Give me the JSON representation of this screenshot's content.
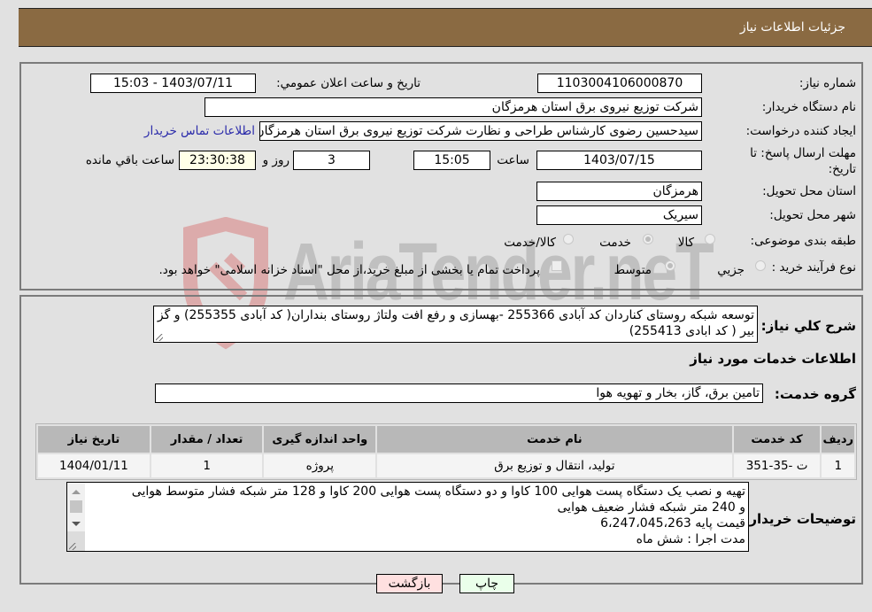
{
  "header": {
    "title": "جزئیات اطلاعات نیاز"
  },
  "form": {
    "need_number": {
      "label": "شماره نیاز:",
      "value": "1103004106000870"
    },
    "announce_datetime": {
      "label": "تاریخ و ساعت اعلان عمومي:",
      "value": "1403/07/11 - 15:03"
    },
    "buyer_org": {
      "label": "نام دستگاه خریدار:",
      "value": "شرکت توزیع نیروی برق استان هرمزگان"
    },
    "requester": {
      "label": "ایجاد کننده درخواست:",
      "value": "سیدحسین رضوی کارشناس طراحی و نظارت شرکت توزیع نیروی برق استان هرمزگان",
      "contact_link": "اطلاعات تماس خریدار"
    },
    "deadline": {
      "label_line1": "مهلت ارسال پاسخ: تا",
      "label_line2": "تاریخ:",
      "date": "1403/07/15",
      "time_label": "ساعت",
      "time": "15:05",
      "days": "3",
      "days_label": "روز و",
      "remaining": "23:30:38",
      "remaining_label": "ساعت باقي مانده"
    },
    "province": {
      "label": "استان محل تحویل:",
      "value": "هرمزگان"
    },
    "city": {
      "label": "شهر محل تحویل:",
      "value": "سیریک"
    },
    "category": {
      "label": "طبقه بندی موضوعی:",
      "options": [
        {
          "label": "کالا",
          "selected": false
        },
        {
          "label": "خدمت",
          "selected": true
        },
        {
          "label": "کالا/خدمت",
          "selected": false
        }
      ]
    },
    "process": {
      "label": "نوع فرآیند خرید :",
      "options": [
        {
          "label": "جزيي",
          "selected": false
        },
        {
          "label": "متوسط",
          "selected": true
        }
      ],
      "treasury_checkbox_label": "پرداخت تمام یا بخشی از مبلغ خرید،از محل \"اسناد خزانه اسلامی\" خواهد بود.",
      "treasury_checked": false
    }
  },
  "description": {
    "label": "شرح کلي نیاز:",
    "value": "توسعه شبکه روستای کناردان کد آبادی 255366 -بهسازی و رفع افت ولتاژ روستای بنداران( کد آبادی 255355) و گز بیر ( کد ابادی 255413)"
  },
  "services": {
    "section_title": "اطلاعات خدمات مورد نیاز",
    "group_label": "گروه خدمت:",
    "group_value": "تامین برق، گاز، بخار و تهویه هوا",
    "table": {
      "headers": [
        "ردیف",
        "کد خدمت",
        "نام خدمت",
        "واحد اندازه گیری",
        "تعداد / مقدار",
        "تاریخ نیاز"
      ],
      "rows": [
        [
          "1",
          "ت -35-351",
          "تولید، انتقال و توزیع برق",
          "پروژه",
          "1",
          "1404/01/11"
        ]
      ]
    }
  },
  "buyer_notes": {
    "label": "توضیحات خریدار:",
    "lines": [
      "تهیه و نصب یک دستگاه پست هوایی 100 کاوا و دو دستگاه پست هوایی 200 کاوا و 128 متر شبکه فشار متوسط هوایی",
      "و 240 متر شبکه فشار ضعیف هوایی",
      "قیمت پایه 6،247،045،263",
      "مدت اجرا : شش ماه"
    ]
  },
  "buttons": {
    "print": "چاپ",
    "back": "بازگشت"
  },
  "watermark": {
    "text": "AriaTender.neT"
  }
}
